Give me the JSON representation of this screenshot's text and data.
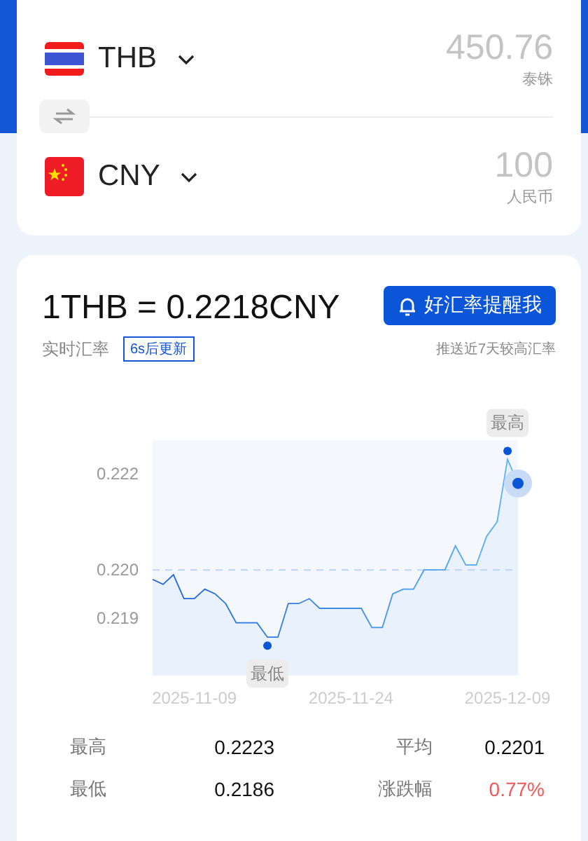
{
  "converter": {
    "rows": [
      {
        "kind": "thailand",
        "code": "THB",
        "amount": "450.76",
        "name": "泰铢"
      },
      {
        "kind": "china",
        "code": "CNY",
        "amount": "100",
        "name": "人民币"
      }
    ]
  },
  "rate": {
    "headline": "1THB = 0.2218CNY",
    "label": "实时汇率",
    "countdown": "6s后更新",
    "alert_button": "好汇率提醒我",
    "alert_note": "推送近7天较高汇率"
  },
  "chart": {
    "chart_data": {
      "type": "area",
      "categories": [
        null,
        null,
        null,
        null,
        "2025-11-09",
        null,
        null,
        null,
        null,
        null,
        null,
        null,
        null,
        null,
        null,
        null,
        null,
        null,
        null,
        "2025-11-24",
        null,
        null,
        null,
        null,
        null,
        null,
        null,
        null,
        null,
        null,
        null,
        null,
        null,
        null,
        "2025-12-09",
        null
      ],
      "ylim": [
        0.2178,
        0.2227
      ],
      "series": [
        {
          "color": "#1a5fd8",
          "values": [
            0.2198,
            0.2197,
            0.2199,
            0.2194,
            0.2194,
            0.2196,
            0.2195,
            0.2193,
            0.2189,
            0.2189,
            0.2189,
            0.2186,
            0.2186,
            0.2193,
            0.2193,
            0.2194,
            0.2192,
            0.2192,
            0.2192,
            0.2192,
            0.2192,
            0.2188,
            0.2188,
            0.2195,
            0.2196,
            0.2196,
            0.22,
            0.22,
            0.22,
            0.2205,
            0.2201,
            0.2201,
            0.2207,
            0.221,
            0.2223,
            0.2218
          ]
        }
      ],
      "yticks": [
        {
          "value": 0.219,
          "label": "0.219"
        },
        {
          "value": 0.22,
          "label": "0.220"
        },
        {
          "value": 0.222,
          "label": "0.222"
        }
      ],
      "ref_lines": [
        {
          "axis": "y",
          "value": 0.22
        }
      ],
      "annotations": [
        {
          "text": "最低",
          "y": 0.2186
        },
        {
          "text": "最高",
          "y": 0.2223
        }
      ]
    }
  },
  "stats": [
    {
      "label": "最高",
      "value": "0.2223",
      "kind": "plain"
    },
    {
      "label": "平均",
      "value": "0.2201",
      "kind": "plain"
    },
    {
      "label": "最低",
      "value": "0.2186",
      "kind": "plain"
    },
    {
      "label": "涨跌幅",
      "value": "0.77%",
      "kind": "rise"
    }
  ]
}
